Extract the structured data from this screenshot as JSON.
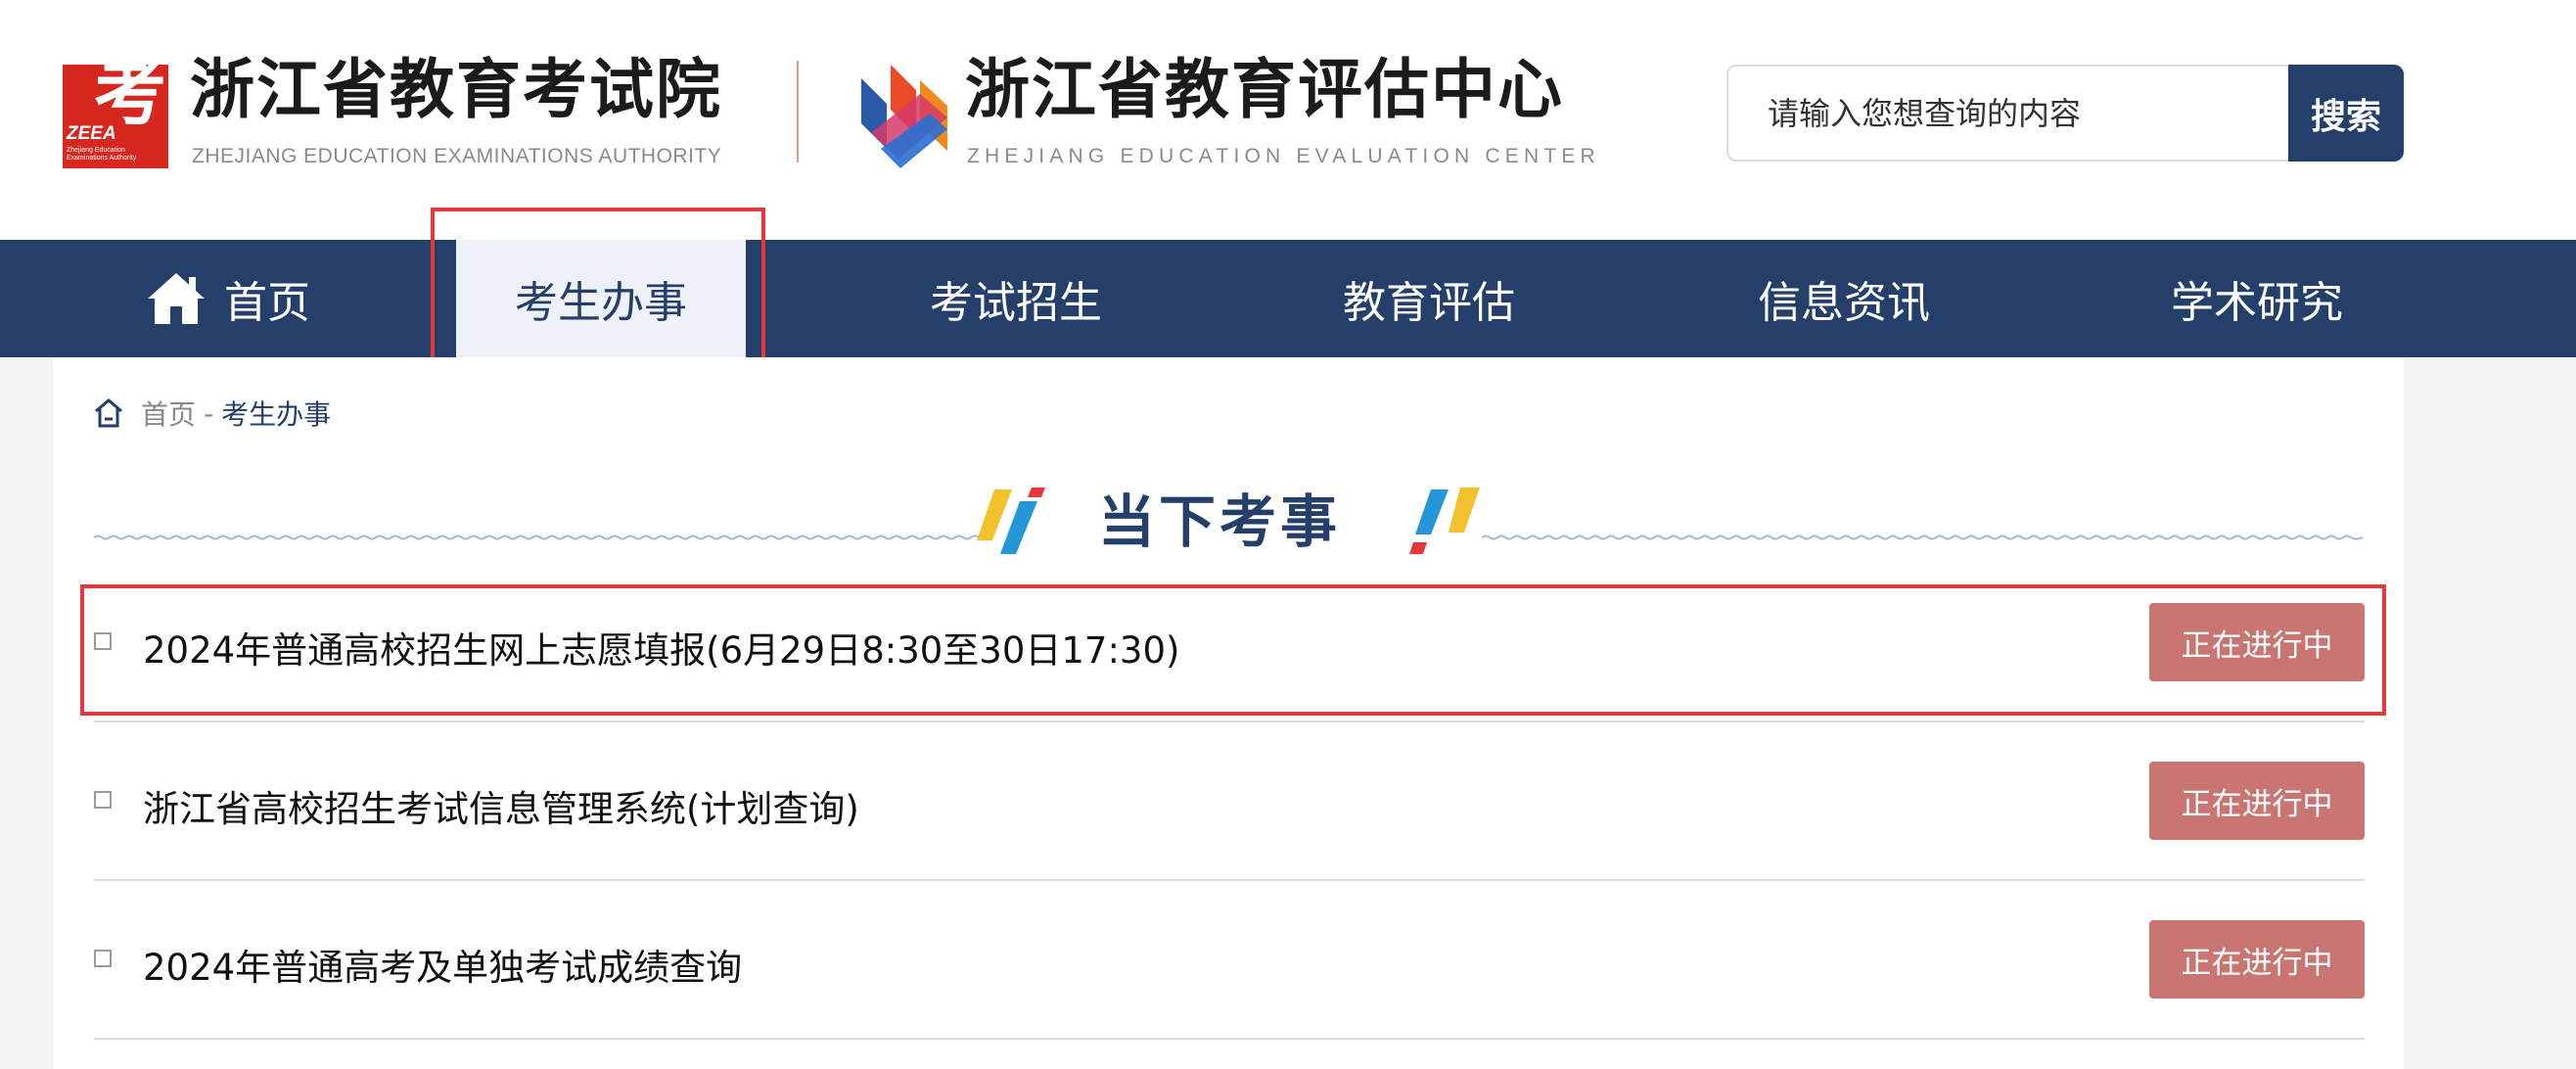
{
  "header": {
    "org1": {
      "name": "浙江省教育考试院",
      "en": "ZHEJIANG EDUCATION EXAMINATIONS AUTHORITY",
      "logo_char": "考",
      "logo_abbr": "ZEEA",
      "logo_small": "Zhejiang Education Examinations Authority"
    },
    "org2": {
      "name": "浙江省教育评估中心",
      "en": "ZHEJIANG EDUCATION EVALUATION CENTER"
    },
    "search": {
      "placeholder": "请输入您想查询的内容",
      "button": "搜索"
    }
  },
  "nav": {
    "items": [
      {
        "label": "首页",
        "icon": "home-icon",
        "active": false
      },
      {
        "label": "考生办事",
        "active": true
      },
      {
        "label": "考试招生",
        "active": false
      },
      {
        "label": "教育评估",
        "active": false
      },
      {
        "label": "信息资讯",
        "active": false
      },
      {
        "label": "学术研究",
        "active": false
      }
    ]
  },
  "breadcrumb": {
    "home": "首页",
    "separator": "-",
    "current": "考生办事"
  },
  "section": {
    "title": "当下考事"
  },
  "events": [
    {
      "title": "2024年普通高校招生网上志愿填报(6月29日8:30至30日17:30)",
      "status": "正在进行中"
    },
    {
      "title": "浙江省高校招生考试信息管理系统(计划查询)",
      "status": "正在进行中"
    },
    {
      "title": "2024年普通高考及单独考试成绩查询",
      "status": "正在进行中"
    }
  ],
  "colors": {
    "nav_bg": "#233f6a",
    "nav_active_bg": "#eef2f8",
    "status_bg": "#c97571",
    "highlight": "#e5383c",
    "logo_red": "#d6281e"
  }
}
